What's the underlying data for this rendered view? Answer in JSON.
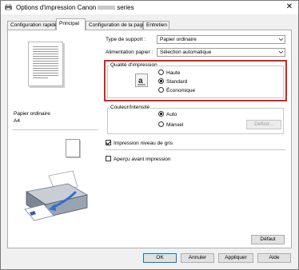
{
  "window": {
    "title_prefix": "Options d'impression Canon",
    "title_suffix": "series",
    "close_glyph": "✕"
  },
  "tabs": [
    {
      "label": "Configuration rapide"
    },
    {
      "label": "Principal"
    },
    {
      "label": "Configuration de la page"
    },
    {
      "label": "Entretien"
    }
  ],
  "preview": {
    "paper_type": "Papier ordinaire",
    "paper_size": "A4"
  },
  "media_type": {
    "label": "Type de support :",
    "value": "Papier ordinaire"
  },
  "paper_source": {
    "label": "Alimentation papier :",
    "value": "Sélection automatique"
  },
  "print_quality": {
    "title": "Qualité d'impression",
    "options": [
      {
        "label": "Haute",
        "selected": false
      },
      {
        "label": "Standard",
        "selected": true
      },
      {
        "label": "Économique",
        "selected": false
      }
    ],
    "highlight_color": "#d9231d"
  },
  "color_intensity": {
    "title": "Couleur/Intensité",
    "options": [
      {
        "label": "Auto",
        "selected": true
      },
      {
        "label": "Manuel",
        "selected": false
      }
    ],
    "set_button": "Définir..."
  },
  "grayscale": {
    "label": "Impression niveau de gris",
    "checked": true
  },
  "preview_before_print": {
    "label": "Aperçu avant impression",
    "checked": false
  },
  "defaults_button": "Défaut",
  "footer": {
    "ok": "OK",
    "cancel": "Annuler",
    "apply": "Appliquer",
    "help": "Aide"
  }
}
